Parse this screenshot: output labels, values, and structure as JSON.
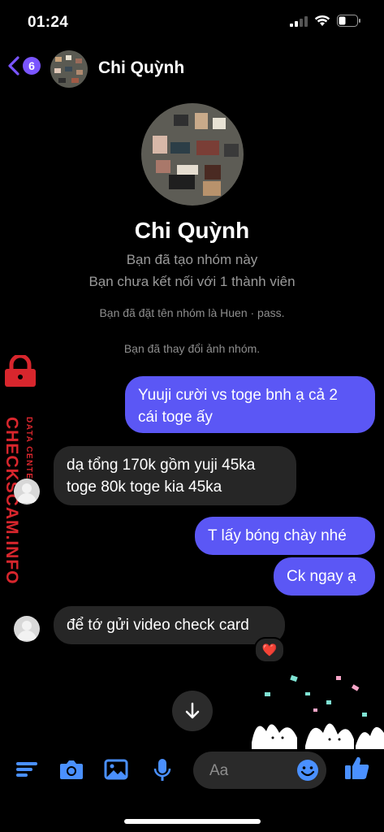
{
  "status_bar": {
    "time": "01:24"
  },
  "header": {
    "back_badge": "6",
    "title": "Chi Quỳnh"
  },
  "profile": {
    "name": "Chi Quỳnh",
    "line1": "Bạn đã tạo nhóm này",
    "line2": "Bạn chưa kết nối với 1 thành viên"
  },
  "system_messages": [
    "Bạn đã đặt tên nhóm là Huen · pass.",
    "Bạn đã thay đổi ảnh nhóm."
  ],
  "messages": [
    {
      "from": "me",
      "text_lines": [
        "Yuuji cười vs toge bnh ạ cả 2",
        "cái toge ấy"
      ]
    },
    {
      "from": "them",
      "text_lines": [
        "dạ tổng 170k gồm yuji 45ka",
        "toge 80k toge kia 45ka"
      ]
    },
    {
      "from": "me",
      "text_lines": [
        "T lấy bóng chày nhé"
      ]
    },
    {
      "from": "me",
      "text_lines": [
        "Ck ngay ạ"
      ]
    },
    {
      "from": "them",
      "text_lines": [
        "để tớ gửi video check card"
      ],
      "reaction": "❤️"
    }
  ],
  "watermark": {
    "brand": "CHECKSCAM.INFO",
    "tagline": "DATA CENTER"
  },
  "composer": {
    "placeholder": "Aa"
  },
  "colors": {
    "outgoing_bubble": "#5b57f5",
    "incoming_bubble": "#262626",
    "accent": "#4a90ff",
    "badge": "#7a55ff"
  },
  "toolbar_icons": [
    "menu-icon",
    "camera-icon",
    "image-icon",
    "microphone-icon",
    "emoji-icon",
    "thumbs-up-icon"
  ]
}
